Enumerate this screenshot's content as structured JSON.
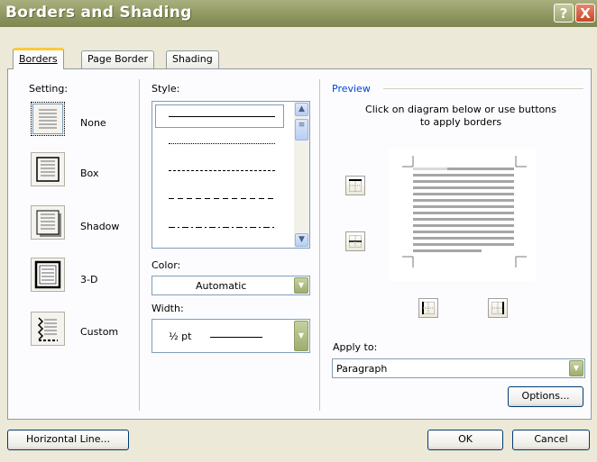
{
  "title": "Borders and Shading",
  "title_buttons": {
    "help": "?",
    "close": "X"
  },
  "tabs": [
    {
      "label": "Borders",
      "active": true
    },
    {
      "label": "Page Border",
      "active": false
    },
    {
      "label": "Shading",
      "active": false
    }
  ],
  "setting": {
    "label": "Setting:",
    "items": [
      {
        "label": "None",
        "icon": "setting-none-icon",
        "selected": true
      },
      {
        "label": "Box",
        "icon": "setting-box-icon",
        "selected": false
      },
      {
        "label": "Shadow",
        "icon": "setting-shadow-icon",
        "selected": false
      },
      {
        "label": "3-D",
        "icon": "setting-3d-icon",
        "selected": false
      },
      {
        "label": "Custom",
        "icon": "setting-custom-icon",
        "selected": false
      }
    ]
  },
  "style": {
    "label": "Style:",
    "options": [
      "solid",
      "dotted",
      "dashed-small",
      "dashed",
      "dash-dot"
    ],
    "selected": "solid"
  },
  "color": {
    "label": "Color:",
    "value": "Automatic"
  },
  "width": {
    "label": "Width:",
    "value": "½ pt"
  },
  "preview": {
    "label": "Preview",
    "hint": "Click on diagram below or use buttons to apply borders"
  },
  "apply_to": {
    "label": "Apply to:",
    "value": "Paragraph"
  },
  "buttons": {
    "options": "Options...",
    "horizontal_line": "Horizontal Line...",
    "ok": "OK",
    "cancel": "Cancel"
  },
  "colors": {
    "title_bar": "#8E955E",
    "tab_highlight": "#FFC83C",
    "accent_green": "#9EAC70"
  }
}
